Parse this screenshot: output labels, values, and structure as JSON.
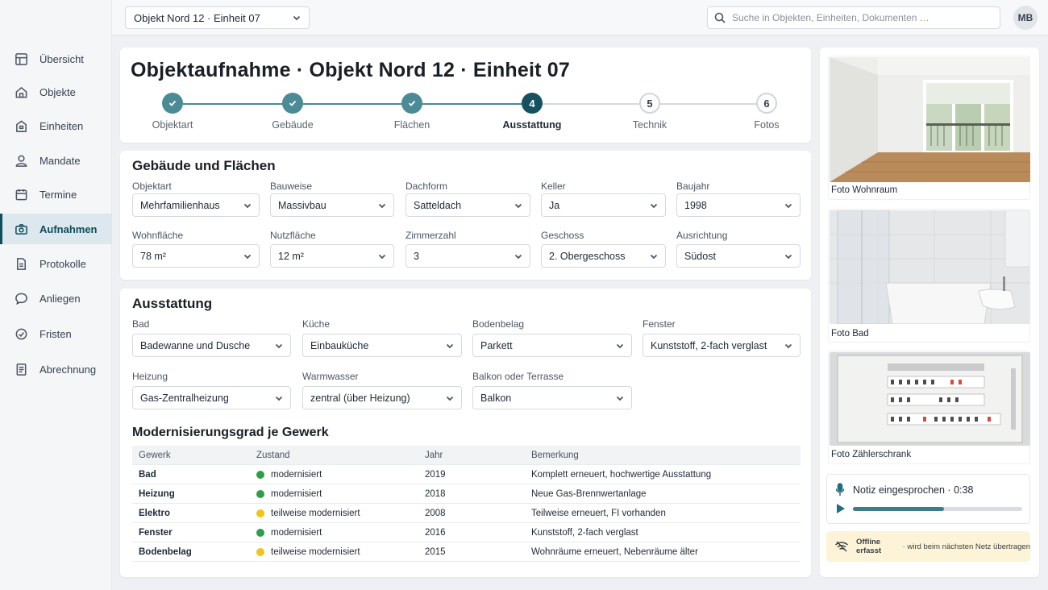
{
  "topbar": {
    "object_select": "Objekt Nord 12 · Einheit 07",
    "search_placeholder": "Suche in Objekten, Einheiten, Dokumenten …",
    "avatar_initials": "MB"
  },
  "sidebar": {
    "items": [
      {
        "label": "Übersicht",
        "icon": "grid-icon"
      },
      {
        "label": "Objekte",
        "icon": "house-icon"
      },
      {
        "label": "Einheiten",
        "icon": "building-icon"
      },
      {
        "label": "Mandate",
        "icon": "person-icon"
      },
      {
        "label": "Termine",
        "icon": "calendar-icon"
      },
      {
        "label": "Aufnahmen",
        "icon": "camera-icon",
        "active": true
      },
      {
        "label": "Protokolle",
        "icon": "document-icon"
      },
      {
        "label": "Anliegen",
        "icon": "chat-icon"
      },
      {
        "label": "Fristen",
        "icon": "clock-icon"
      },
      {
        "label": "Abrechnung",
        "icon": "invoice-icon"
      }
    ]
  },
  "header": {
    "title": "Objektaufnahme · Objekt Nord 12 · Einheit 07",
    "steps": [
      {
        "number": "1",
        "label": "Objektart",
        "state": "done"
      },
      {
        "number": "2",
        "label": "Gebäude",
        "state": "done"
      },
      {
        "number": "3",
        "label": "Flächen",
        "state": "done"
      },
      {
        "number": "4",
        "label": "Ausstattung",
        "state": "current"
      },
      {
        "number": "5",
        "label": "Technik",
        "state": "todo"
      },
      {
        "number": "6",
        "label": "Fotos",
        "state": "todo"
      }
    ]
  },
  "building": {
    "title": "Gebäude und Flächen",
    "fields": [
      {
        "label": "Objektart",
        "value": "Mehrfamilienhaus"
      },
      {
        "label": "Bauweise",
        "value": "Massivbau"
      },
      {
        "label": "Dachform",
        "value": "Satteldach"
      },
      {
        "label": "Keller",
        "value": "Ja"
      },
      {
        "label": "Baujahr",
        "value": "1998"
      },
      {
        "label": "Wohnfläche",
        "value": "78 m²"
      },
      {
        "label": "Nutzfläche",
        "value": "12 m²"
      },
      {
        "label": "Zimmerzahl",
        "value": "3"
      },
      {
        "label": "Geschoss",
        "value": "2. Obergeschoss"
      },
      {
        "label": "Ausrichtung",
        "value": "Südost"
      }
    ]
  },
  "equipment": {
    "title": "Ausstattung",
    "fields": [
      {
        "label": "Bad",
        "value": "Badewanne und Dusche"
      },
      {
        "label": "Küche",
        "value": "Einbauküche"
      },
      {
        "label": "Bodenbelag",
        "value": "Parkett"
      },
      {
        "label": "Fenster",
        "value": "Kunststoff, 2-fach verglast"
      },
      {
        "label": "Heizung",
        "value": "Gas-Zentralheizung"
      },
      {
        "label": "Warmwasser",
        "value": "zentral (über Heizung)"
      },
      {
        "label": "Balkon oder Terrasse",
        "value": "Balkon"
      }
    ]
  },
  "modernization": {
    "title": "Modernisierungsgrad je Gewerk",
    "columns": [
      "Gewerk",
      "Zustand",
      "Jahr",
      "Bemerkung"
    ],
    "rows": [
      {
        "trade": "Bad",
        "status": "modernisiert",
        "status_color": "#2e9e4a",
        "year": "2019",
        "note": "Komplett erneuert, hochwertige Ausstattung"
      },
      {
        "trade": "Heizung",
        "status": "modernisiert",
        "status_color": "#2e9e4a",
        "year": "2018",
        "note": "Neue Gas-Brennwertanlage"
      },
      {
        "trade": "Elektro",
        "status": "teilweise modernisiert",
        "status_color": "#f2c318",
        "year": "2008",
        "note": "Teilweise erneuert, FI vorhanden"
      },
      {
        "trade": "Fenster",
        "status": "modernisiert",
        "status_color": "#2e9e4a",
        "year": "2016",
        "note": "Kunststoff, 2-fach verglast"
      },
      {
        "trade": "Bodenbelag",
        "status": "teilweise modernisiert",
        "status_color": "#f2c318",
        "year": "2015",
        "note": "Wohnräume erneuert, Nebenräume älter"
      }
    ]
  },
  "photos": [
    {
      "caption": "Foto Wohnraum"
    },
    {
      "caption": "Foto Bad"
    },
    {
      "caption": "Foto Zählerschrank"
    }
  ],
  "audio": {
    "label": "Notiz eingesprochen · 0:38",
    "progress": 0.54
  },
  "offline": {
    "strong": "Offline erfasst",
    "rest": " · wird beim nächsten Netz übertragen"
  },
  "colors": {
    "accent": "#0f4c5c",
    "step_done": "#4a8b96",
    "step_current": "#16515f",
    "offline_bg": "#fdf3d7"
  }
}
